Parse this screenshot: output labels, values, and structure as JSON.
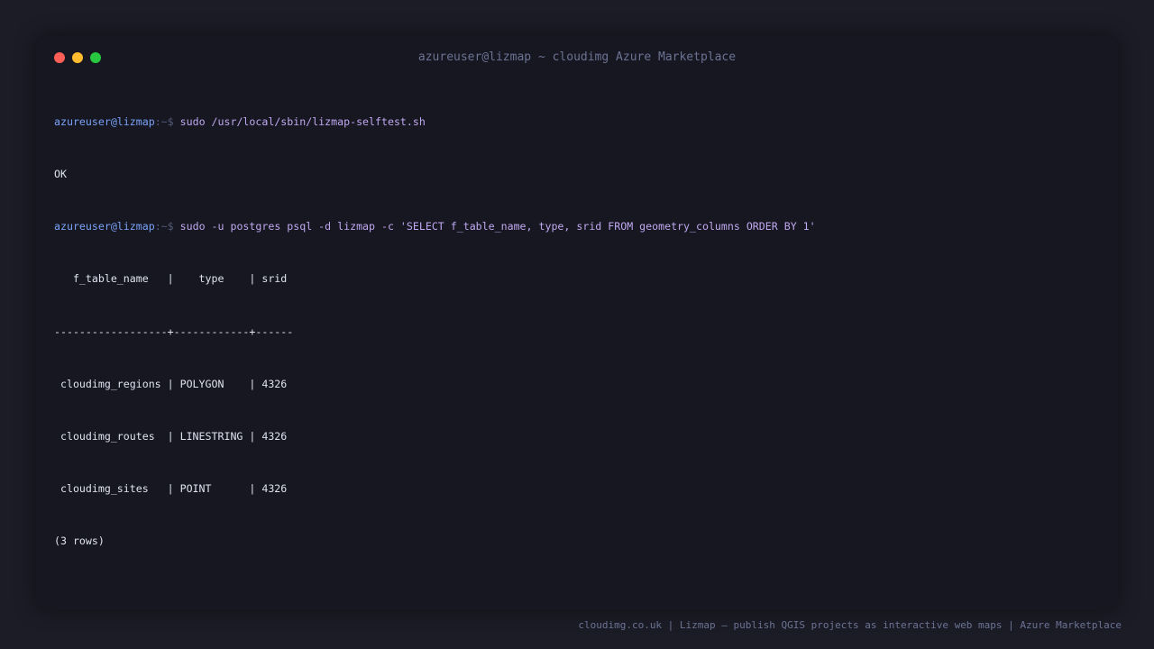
{
  "window": {
    "title": "azureuser@lizmap ~ cloudimg Azure Marketplace",
    "controls": {
      "close_color": "#ff5f57",
      "minimize_color": "#febc2e",
      "maximize_color": "#28c840"
    }
  },
  "terminal": {
    "prompt_user": "azureuser@lizmap",
    "prompt_path": ":~$",
    "commands": [
      "sudo /usr/local/sbin/lizmap-selftest.sh",
      "sudo -u postgres psql -d lizmap -c 'SELECT f_table_name, type, srid FROM geometry_columns ORDER BY 1'"
    ],
    "output_lines": {
      "selftest_result": "OK",
      "table_header": "   f_table_name   |    type    | srid",
      "table_separator": "------------------+------------+------",
      "rows": [
        " cloudimg_regions | POLYGON    | 4326",
        " cloudimg_routes  | LINESTRING | 4326",
        " cloudimg_sites   | POINT      | 4326"
      ],
      "row_count": "(3 rows)"
    }
  },
  "footer": {
    "text": "cloudimg.co.uk | Lizmap — publish QGIS projects as interactive web maps | Azure Marketplace"
  }
}
